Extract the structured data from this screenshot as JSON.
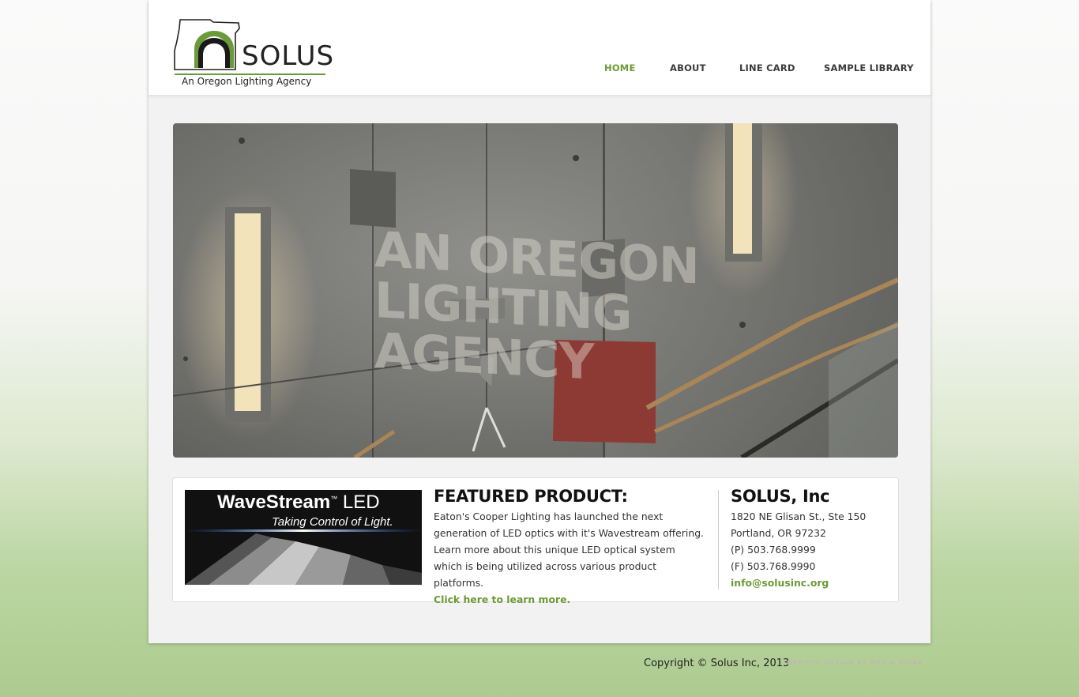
{
  "logo": {
    "name": "SOLUS",
    "tagline": "An Oregon Lighting Agency",
    "accent_color": "#6a9a3a"
  },
  "nav": {
    "items": [
      {
        "label": "HOME",
        "active": true
      },
      {
        "label": "ABOUT",
        "active": false
      },
      {
        "label": "LINE CARD",
        "active": false
      },
      {
        "label": "SAMPLE LIBRARY",
        "active": false
      }
    ],
    "active_color": "#6c9a37"
  },
  "hero": {
    "line1": "AN OREGON",
    "line2": "LIGHTING AGENCY"
  },
  "promo": {
    "title": "WaveStream",
    "trademark": "™",
    "suffix": "LED",
    "subtitle": "Taking Control of Light."
  },
  "featured": {
    "heading": "FEATURED PRODUCT:",
    "body": "Eaton's Cooper Lighting has launched the next generation of LED optics with it's Wavestream offering. Learn more about this unique LED optical system which is being utilized across various product platforms.",
    "link": "Click here to learn more."
  },
  "company": {
    "heading": "SOLUS, Inc",
    "address1": "1820 NE Glisan St., Ste 150",
    "address2": "Portland, OR 97232",
    "phone": "(P) 503.768.9999",
    "fax": "(F) 503.768.9990",
    "email": "info@solusinc.org"
  },
  "footer": {
    "copyright": "Copyright © Solus Inc, 2013",
    "credit": "WEBSITE DESIGN BY MEDIA DRINK"
  }
}
